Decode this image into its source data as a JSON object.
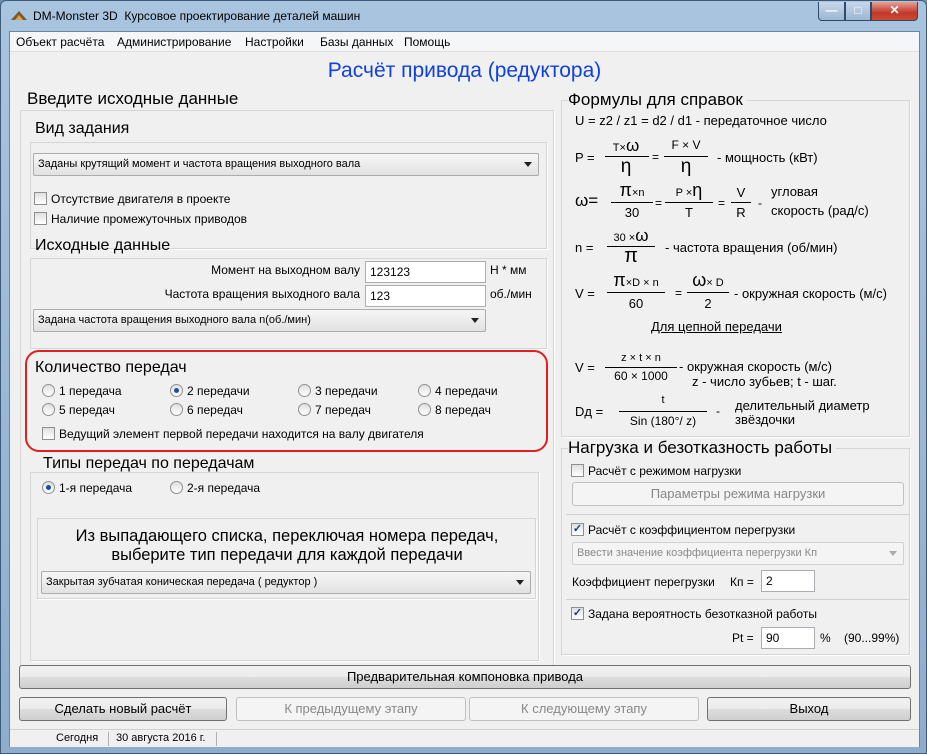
{
  "window": {
    "app_name": "DM-Monster 3D",
    "subtitle": "Курсовое проектирование деталей машин",
    "minimize": "—",
    "maximize": "□",
    "close": "✕"
  },
  "menu": [
    "Объект расчёта",
    "Администрирование",
    "Настройки",
    "Базы данных",
    "Помощь"
  ],
  "main_title": "Расчёт привода (редуктора)",
  "input": {
    "heading": "Введите исходные данные",
    "task_type": {
      "heading": "Вид задания",
      "select": "Заданы крутящий момент и частота вращения выходного вала",
      "no_engine": "Отсутствие двигателя в проекте",
      "no_engine_checked": false,
      "intermediate": "Наличие промежуточных приводов",
      "intermediate_checked": false
    },
    "source": {
      "heading": "Исходные данные",
      "torque_label": "Момент на выходном валу",
      "torque_value": "123123",
      "torque_unit": "Н * мм",
      "freq_label": "Частота вращения выходного вала",
      "freq_value": "123",
      "freq_unit": "об./мин",
      "freq_select": "Задана частота вращения выходного вала n(об./мин)"
    },
    "gears": {
      "heading": "Количество передач",
      "options": [
        "1 передача",
        "2 передачи",
        "3 передачи",
        "4 передачи",
        "5 передач",
        "6 передач",
        "7 передач",
        "8 передач"
      ],
      "selected": "2 передачи",
      "lead_label": "Ведущий элемент первой передачи находится на валу двигателя",
      "lead_checked": false
    },
    "types": {
      "heading": "Типы передач по передачам",
      "options": [
        "1-я передача",
        "2-я передача"
      ],
      "selected": "1-я передача",
      "hint1": "Из выпадающего списка, переключая номера передач,",
      "hint2": "выберите тип передачи для каждой передачи",
      "select": "Закрытая зубчатая коническая передача ( редуктор )"
    }
  },
  "formulas": {
    "heading": "Формулы для справок",
    "u": "U = z2 / z1 = d2 / d1 - передаточное число",
    "p_lhs": "P =",
    "p_n1": "T×",
    "p_n1w": "ω",
    "p_d1": "η",
    "p_eq": "=",
    "p_n2": "F × V",
    "p_d2": "η",
    "p_desc": "- мощность (кВт)",
    "w_lhs": "ω=",
    "w_n1": "π",
    "w_n1b": "×n",
    "w_d1": "30",
    "w_n2": "P ×",
    "w_n2e": "η",
    "w_d2": "T",
    "w_n3": "V",
    "w_d3": "R",
    "w_desc1": "угловая",
    "w_desc2": "скорость (рад/с)",
    "n_lhs": "n =",
    "n_num": "30 ×",
    "n_numw": "ω",
    "n_den": "π",
    "n_desc": "- частота вращения (об/мин)",
    "v_lhs": "V =",
    "v_n1": "π",
    "v_n1b": "×D × n",
    "v_d1": "60",
    "v_n2w": "ω",
    "v_n2b": "× D",
    "v_d2": "2",
    "v_desc": "- окружная скорость (м/с)",
    "chain_title": "Для цепной передачи",
    "vc_lhs": "V =",
    "vc_num": "z × t × n",
    "vc_den": "60 × 1000",
    "vc_desc1": "- окружная скорость (м/с)",
    "vc_desc2": "z - число зубьев; t - шаг.",
    "dd_lhs": "Dд =",
    "dd_num": "t",
    "dd_den": "Sin (180°/ z)",
    "dd_desc1": "делительный диаметр",
    "dd_desc2": "звёздочки"
  },
  "load": {
    "heading": "Нагрузка и безотказность работы",
    "mode_label": "Расчёт с режимом нагрузки",
    "mode_checked": false,
    "mode_btn": "Параметры режима нагрузки",
    "over_label": "Расчёт с коэффициентом перегрузки",
    "over_checked": true,
    "over_select": "Ввести значение коэффициента перегрузки Кп",
    "kp_label": "Коэффициент перегрузки",
    "kp_sym": "Кп =",
    "kp_value": "2",
    "prob_label": "Задана вероятность безотказной работы",
    "prob_checked": true,
    "pt_sym": "Pt =",
    "pt_value": "90",
    "pt_unit": "%",
    "pt_range": "(90...99%)"
  },
  "buttons": {
    "precompose": "Предварительная компоновка привода",
    "new_calc": "Сделать новый расчёт",
    "prev": "К предыдущему этапу",
    "next": "К следующему этапу",
    "exit": "Выход"
  },
  "status": {
    "today": "Сегодня",
    "date": "30 августа 2016 г."
  },
  "colors": {
    "title_blue": "#1140e0",
    "highlight_red": "#e02020",
    "window_frame": "#8eaccc"
  }
}
